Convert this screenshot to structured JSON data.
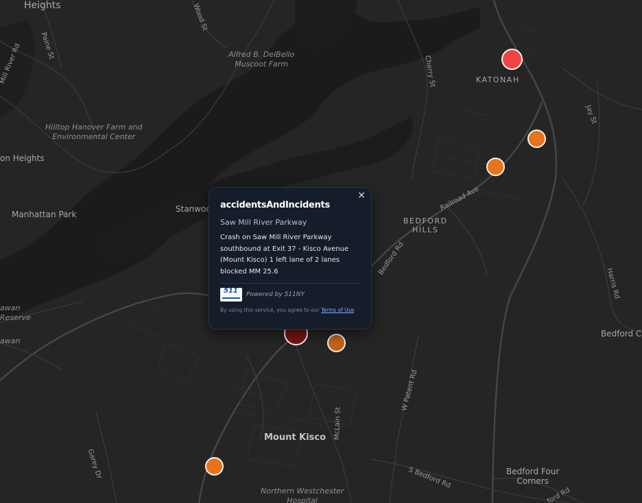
{
  "map": {
    "place_labels": {
      "heights_top": "Heights",
      "katonah": "KATONAH",
      "bedford_hills": "BEDFORD\nHILLS",
      "mount_kisco": "Mount Kisco",
      "manhattan_park": "Manhattan Park",
      "heights_left": "on Heights",
      "stanwood": "Stanwood",
      "bedford_four_corners": "Bedford Four\nCorners",
      "bedford_corners_right": "Bedford Co",
      "wawan_1": "awan",
      "wawan_reserve": "Reserve",
      "wawan_2": "awan"
    },
    "park_labels": {
      "muscoot": "Alfred B. DelBello\nMuscoot Farm",
      "hilltop": "Hilltop Hanover Farm and\nEnvironmental Center",
      "hospital": "Northern Westchester\nHospital"
    },
    "street_labels": {
      "paine": "Paine St",
      "wood": "Wood St",
      "mill_river": "Mill River Rd",
      "cherry": "Cherry St",
      "jay": "Jay St",
      "railroad": "Railroad Ave",
      "bedford_rd": "Bedford Rd",
      "harris": "Harris Rd",
      "w_patent": "W Patent Rd",
      "mclain": "McLain St",
      "garey": "Garey Dr",
      "s_bedford": "S Bedford Rd",
      "ford_rd": "ford Rd"
    },
    "markers": [
      {
        "name": "incident-marker-katonah",
        "color": "#ef4444",
        "severity": "high"
      },
      {
        "name": "incident-marker-route22-north",
        "color": "#e8731a",
        "severity": "medium"
      },
      {
        "name": "incident-marker-route22-south",
        "color": "#e8731a",
        "severity": "medium"
      },
      {
        "name": "incident-marker-selected",
        "color": "#7a1414",
        "severity": "selected"
      },
      {
        "name": "incident-marker-kisco-east",
        "color": "#c2621a",
        "severity": "medium"
      },
      {
        "name": "incident-marker-kisco-south",
        "color": "#e8731a",
        "severity": "medium"
      }
    ]
  },
  "popup": {
    "title": "accidentsAndIncidents",
    "close_icon": "×",
    "road": "Saw Mill River Parkway",
    "description": "Crash on Saw Mill River Parkway southbound at Exit 37 - Kisco Avenue (Mount Kisco) 1 left lane of 2 lanes blocked MM 25.6",
    "logo_text": "511",
    "powered_by": "Powered by 511NY",
    "terms_prefix": "By using this service, you agree to our ",
    "terms_link": "Terms of Use"
  },
  "colors": {
    "background": "#252525",
    "water": "#181818",
    "road_major": "#4a4a4a",
    "road_minor": "#363636",
    "popup_bg": "#151c2a",
    "link": "#7fb0ff"
  }
}
